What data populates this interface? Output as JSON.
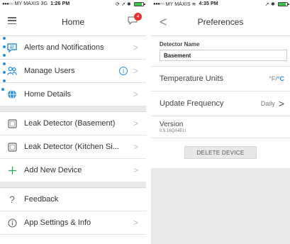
{
  "left_screen": {
    "status": {
      "dots": "●●●○○",
      "carrier": "MY MAXIS",
      "network": "3G",
      "time": "1:26 PM",
      "icons": "⟳ ➚ ✱",
      "battery_fraction": 0.8
    },
    "header": {
      "title": "Home",
      "badge_count": "4"
    },
    "menu": [
      {
        "label": "Alerts and Notifications",
        "icon": "chat-bubble-icon"
      },
      {
        "label": "Manage Users",
        "icon": "users-icon",
        "info": "i"
      },
      {
        "label": "Home Details",
        "icon": "globe-icon"
      },
      {
        "label": "Leak Detector (Basement)",
        "icon": "device-square-icon"
      },
      {
        "label": "Leak Detector (Kitchen Si...",
        "icon": "device-square-icon"
      },
      {
        "label": "Add New Device",
        "icon": "plus-icon"
      },
      {
        "label": "Feedback",
        "icon": "question-icon"
      },
      {
        "label": "App Settings & Info",
        "icon": "info-icon"
      }
    ],
    "chevron": ">"
  },
  "right_screen": {
    "status": {
      "dots": "●●●○○",
      "carrier": "MY MAXIS",
      "wifi": "≋",
      "time": "4:35 PM",
      "icons": "➚ ✱",
      "battery_fraction": 0.85
    },
    "header": {
      "title": "Preferences",
      "back": "<"
    },
    "detector_name_label": "Detector Name",
    "detector_name_value": "Basement",
    "temperature_label": "Temperature Units",
    "temperature_f": "°F/",
    "temperature_c": "°C",
    "update_label": "Update Frequency",
    "update_value": "Daily",
    "update_chevron": ">",
    "version_label": "Version",
    "version_value": "0.5.16QA4EU",
    "delete_button": "DELETE DEVICE"
  },
  "colors": {
    "accent": "#2a8fd6",
    "badge": "#e8312f",
    "add_plus": "#2aa85a",
    "battery": "#3cc44a"
  }
}
